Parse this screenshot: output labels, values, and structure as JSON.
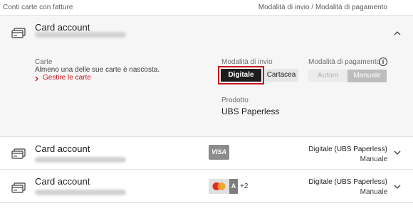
{
  "header": {
    "left": "Conti carte con fatture",
    "right": "Modalità di invio / Modalità di pagamento"
  },
  "accounts": [
    {
      "title": "Card account",
      "expanded": true,
      "carte_label": "Carte",
      "hidden_notice": "Almeno una delle sue carte è nascosta.",
      "manage_link": "Gestire le carte",
      "invio_label": "Modalità di invio",
      "invio_options": [
        "Digitale",
        "Cartacea"
      ],
      "pagamento_label": "Modalità di pagamento",
      "pagamento_options": [
        "Autom",
        "Manuale"
      ],
      "prodotto_label": "Prodotto",
      "prodotto_value": "UBS Paperless"
    },
    {
      "title": "Card account",
      "card_badge": "VISA",
      "status": "Digitale (UBS Paperless)",
      "payment": "Manuale"
    },
    {
      "title": "Card account",
      "more_cards": "+2",
      "amex_badge": "A",
      "status": "Digitale (UBS Paperless)",
      "payment": "Manuale"
    }
  ],
  "colors": {
    "accent_red": "#c4151c",
    "selected_dark": "#1c1c1c",
    "expanded_bg": "#f6f6f6"
  },
  "icons": {
    "card": "credit-card-icon",
    "collapse": "chevron-up-icon",
    "expand": "chevron-down-icon",
    "info": "info-icon",
    "link_arrow": "chevron-right-icon"
  }
}
